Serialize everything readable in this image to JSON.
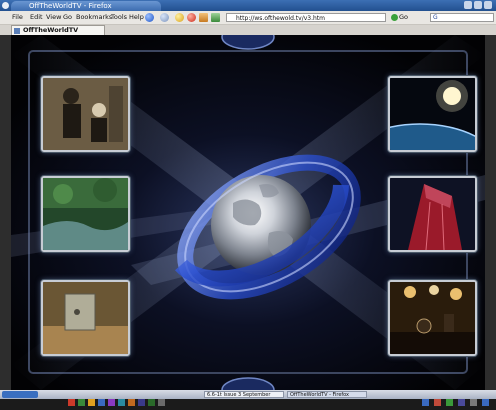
{
  "window": {
    "title": "OffTheWorldTV - Firefox"
  },
  "menubar": {
    "items": [
      "File",
      "Edit",
      "View",
      "Go",
      "Bookmarks",
      "Tools",
      "Help"
    ],
    "url": "http://ws.ofthewold.tv/v3.htm",
    "go_label": "Go",
    "search_placeholder": "G"
  },
  "tabs": [
    {
      "label": "OffTheWorldTV"
    }
  ],
  "page": {
    "thumbnails": [
      {
        "name": "thumb-silent-film",
        "position": "left-top"
      },
      {
        "name": "thumb-forest-stream",
        "position": "left-middle"
      },
      {
        "name": "thumb-vault-room",
        "position": "left-bottom"
      },
      {
        "name": "thumb-planet-sun",
        "position": "right-top"
      },
      {
        "name": "thumb-skyscraper",
        "position": "right-middle"
      },
      {
        "name": "thumb-concert-stage",
        "position": "right-bottom"
      }
    ]
  },
  "taskbar": {
    "items": [
      "6.6-1t Issue 3 September",
      "OffTheWorldTV - Firefox"
    ]
  },
  "colors": {
    "accent": "#3c6fb4",
    "globe_blue": "#2a4fd1",
    "background": "#050608"
  }
}
